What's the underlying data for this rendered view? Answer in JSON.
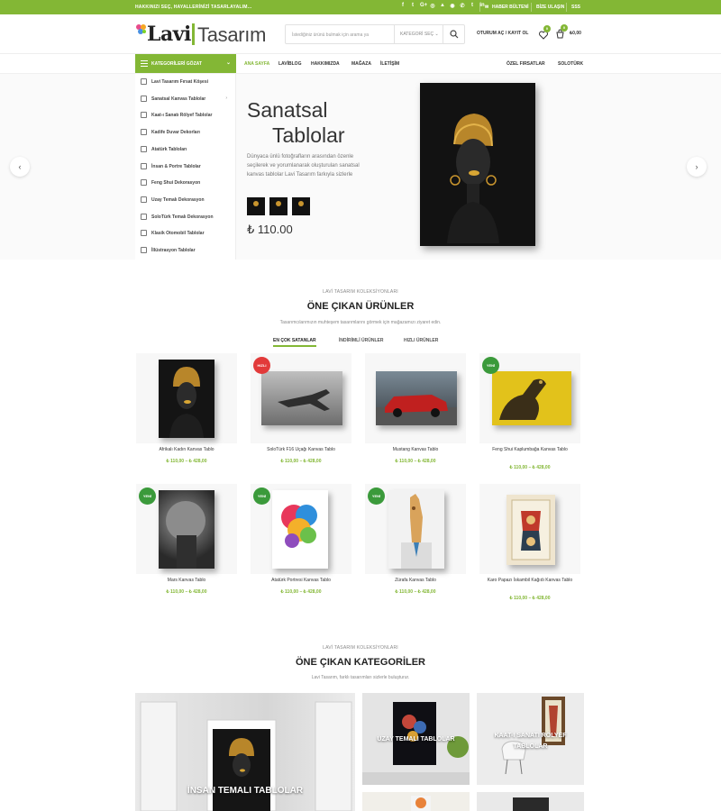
{
  "topbar": {
    "text": "HAKKINIZI SEÇ, HAYALLERİNİZİ TASARLAYALIM...",
    "socials": [
      "f",
      "t",
      "G+",
      "◎",
      "▲",
      "◉",
      "✆",
      "t",
      "in"
    ],
    "newsletter": "HABER BÜLTENİ",
    "contact": "BİZE ULAŞIN",
    "faq": "SSS"
  },
  "brand": {
    "logo_left": "Lavi",
    "logo_right": "Tasarım"
  },
  "search": {
    "placeholder": "İstediğiniz ürünü bulmak için arama ya",
    "category": "KATEGORİ SEÇ"
  },
  "header": {
    "login": "OTURUM AÇ / KAYIT OL",
    "wishlist_count": "0",
    "cart_count": "0",
    "cart_total": "₺0,00"
  },
  "nav": {
    "categories_label": "KATEGORİLERİ GÖZAT",
    "links": [
      "ANA SAYFA",
      "LAVİBLOG",
      "HAKKIMIZDA",
      "MAĞAZA",
      "İLETİŞİM"
    ],
    "right": [
      "ÖZEL FIRSATLAR",
      "SOLOTÜRK"
    ]
  },
  "side_menu": [
    "Lavi Tasarım Fırsat Köşesi",
    "Sanatsal Kanvas Tablolar",
    "Kaat-ı Sanatı Rölyef Tablolar",
    "Kadife Duvar Dekorları",
    "Atatürk Tabloları",
    "İnsan & Portre Tablolar",
    "Feng Shui Dekorasyon",
    "Uzay Temalı Dekorasyon",
    "SoloTürk Temalı Dekorasyon",
    "Klasik Otomobil Tablolar",
    "İllüstrasyon Tablolar"
  ],
  "hero": {
    "title_line1": "Sanatsal",
    "title_line2": "Tablolar",
    "description": "Dünyaca ünlü fotoğrafların arasından özenle seçilerek ve yorumlanarak oluşturulan sanatsal kanvas tablolar Lavi Tasarım farkıyla sizlerle",
    "price": "₺ 110.00",
    "prev": "‹",
    "next": "›"
  },
  "featured": {
    "subtitle": "LAVİ TASARIM KOLEKSİYONLARI",
    "title": "ÖNE ÇIKAN ÜRÜNLER",
    "description": "Tasarımcılarımızın muhteşem tasarımlarını görmek için mağazamızı ziyaret edin.",
    "tabs": [
      "EN ÇOK SATANLAR",
      "İNDİRİMLİ ÜRÜNLER",
      "HIZLI ÜRÜNLER"
    ]
  },
  "products": [
    {
      "name": "Afrikalı Kadın Kanvas Tablo",
      "price": "₺ 110,00 – ₺ 428,00",
      "badge": ""
    },
    {
      "name": "SoloTürk F16 Uçağı Kanvas Tablo",
      "price": "₺ 110,00 – ₺ 428,00",
      "badge": "HIZLI"
    },
    {
      "name": "Mustang Kanvas Tablo",
      "price": "₺ 110,00 – ₺ 428,00",
      "badge": ""
    },
    {
      "name": "Feng Shui Kaplumbağa Kanvas Tablo",
      "price": "₺ 110,00 – ₺ 428,00",
      "badge": "YENİ"
    },
    {
      "name": "Mars Kanvas Tablo",
      "price": "₺ 110,00 – ₺ 428,00",
      "badge": "YENİ"
    },
    {
      "name": "Atatürk Portresi Kanvas Tablo",
      "price": "₺ 110,00 – ₺ 428,00",
      "badge": "YENİ"
    },
    {
      "name": "Zürafa Kanvas Tablo",
      "price": "₺ 110,00 – ₺ 428,00",
      "badge": "YENİ"
    },
    {
      "name": "Karo Papazı İskambil Kağıdı Kanvas Tablo",
      "price": "₺ 110,00 – ₺ 428,00",
      "badge": ""
    }
  ],
  "categories_section": {
    "subtitle": "LAVİ TASARIM KOLEKSİYONLARI",
    "title": "ÖNE ÇIKAN KATEGORİLER",
    "description": "Lavi Tasarım, farklı tasarımları sizlerle buluşturur.",
    "tiles": [
      "İNSAN TEMALI TABLOLAR",
      "UZAY TEMALI TABLOLAR",
      "KAAT-I SANATI RÖLYEF TABLOLAR"
    ]
  },
  "colors": {
    "accent": "#83b735",
    "badge_hot": "#e23a3a",
    "badge_new": "#3b9a3b"
  }
}
